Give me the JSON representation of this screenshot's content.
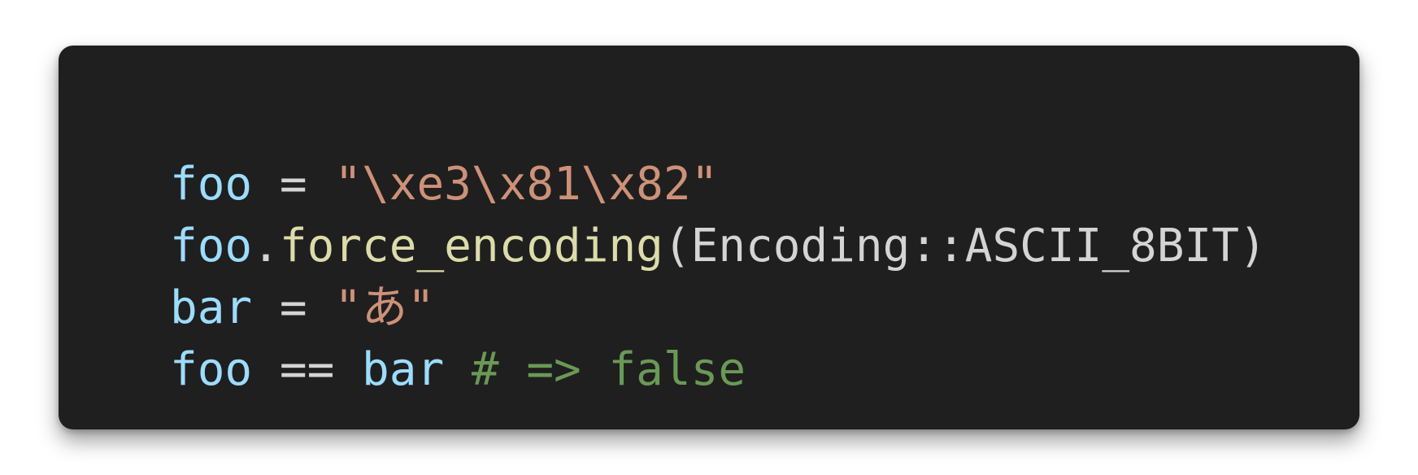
{
  "colors": {
    "background": "#ffffff",
    "editor_background": "#1f1f1f",
    "variable": "#9cdcfe",
    "operator": "#d4d4d4",
    "string": "#ce9178",
    "function": "#dcdcaa",
    "plain": "#d4d4d4",
    "comment": "#6a9955"
  },
  "code": {
    "language": "ruby",
    "lines": [
      [
        {
          "text": "foo",
          "kind": "variable"
        },
        {
          "text": " = ",
          "kind": "operator"
        },
        {
          "text": "\"\\xe3\\x81\\x82\"",
          "kind": "string"
        }
      ],
      [
        {
          "text": "foo",
          "kind": "variable"
        },
        {
          "text": ".",
          "kind": "plain"
        },
        {
          "text": "force_encoding",
          "kind": "function"
        },
        {
          "text": "(Encoding::ASCII_8BIT)",
          "kind": "plain"
        }
      ],
      [
        {
          "text": "bar",
          "kind": "variable"
        },
        {
          "text": " = ",
          "kind": "operator"
        },
        {
          "text": "\"あ\"",
          "kind": "string"
        }
      ],
      [
        {
          "text": "foo",
          "kind": "variable"
        },
        {
          "text": " == ",
          "kind": "operator"
        },
        {
          "text": "bar",
          "kind": "variable"
        },
        {
          "text": " ",
          "kind": "plain"
        },
        {
          "text": "# => false",
          "kind": "comment"
        }
      ]
    ]
  }
}
